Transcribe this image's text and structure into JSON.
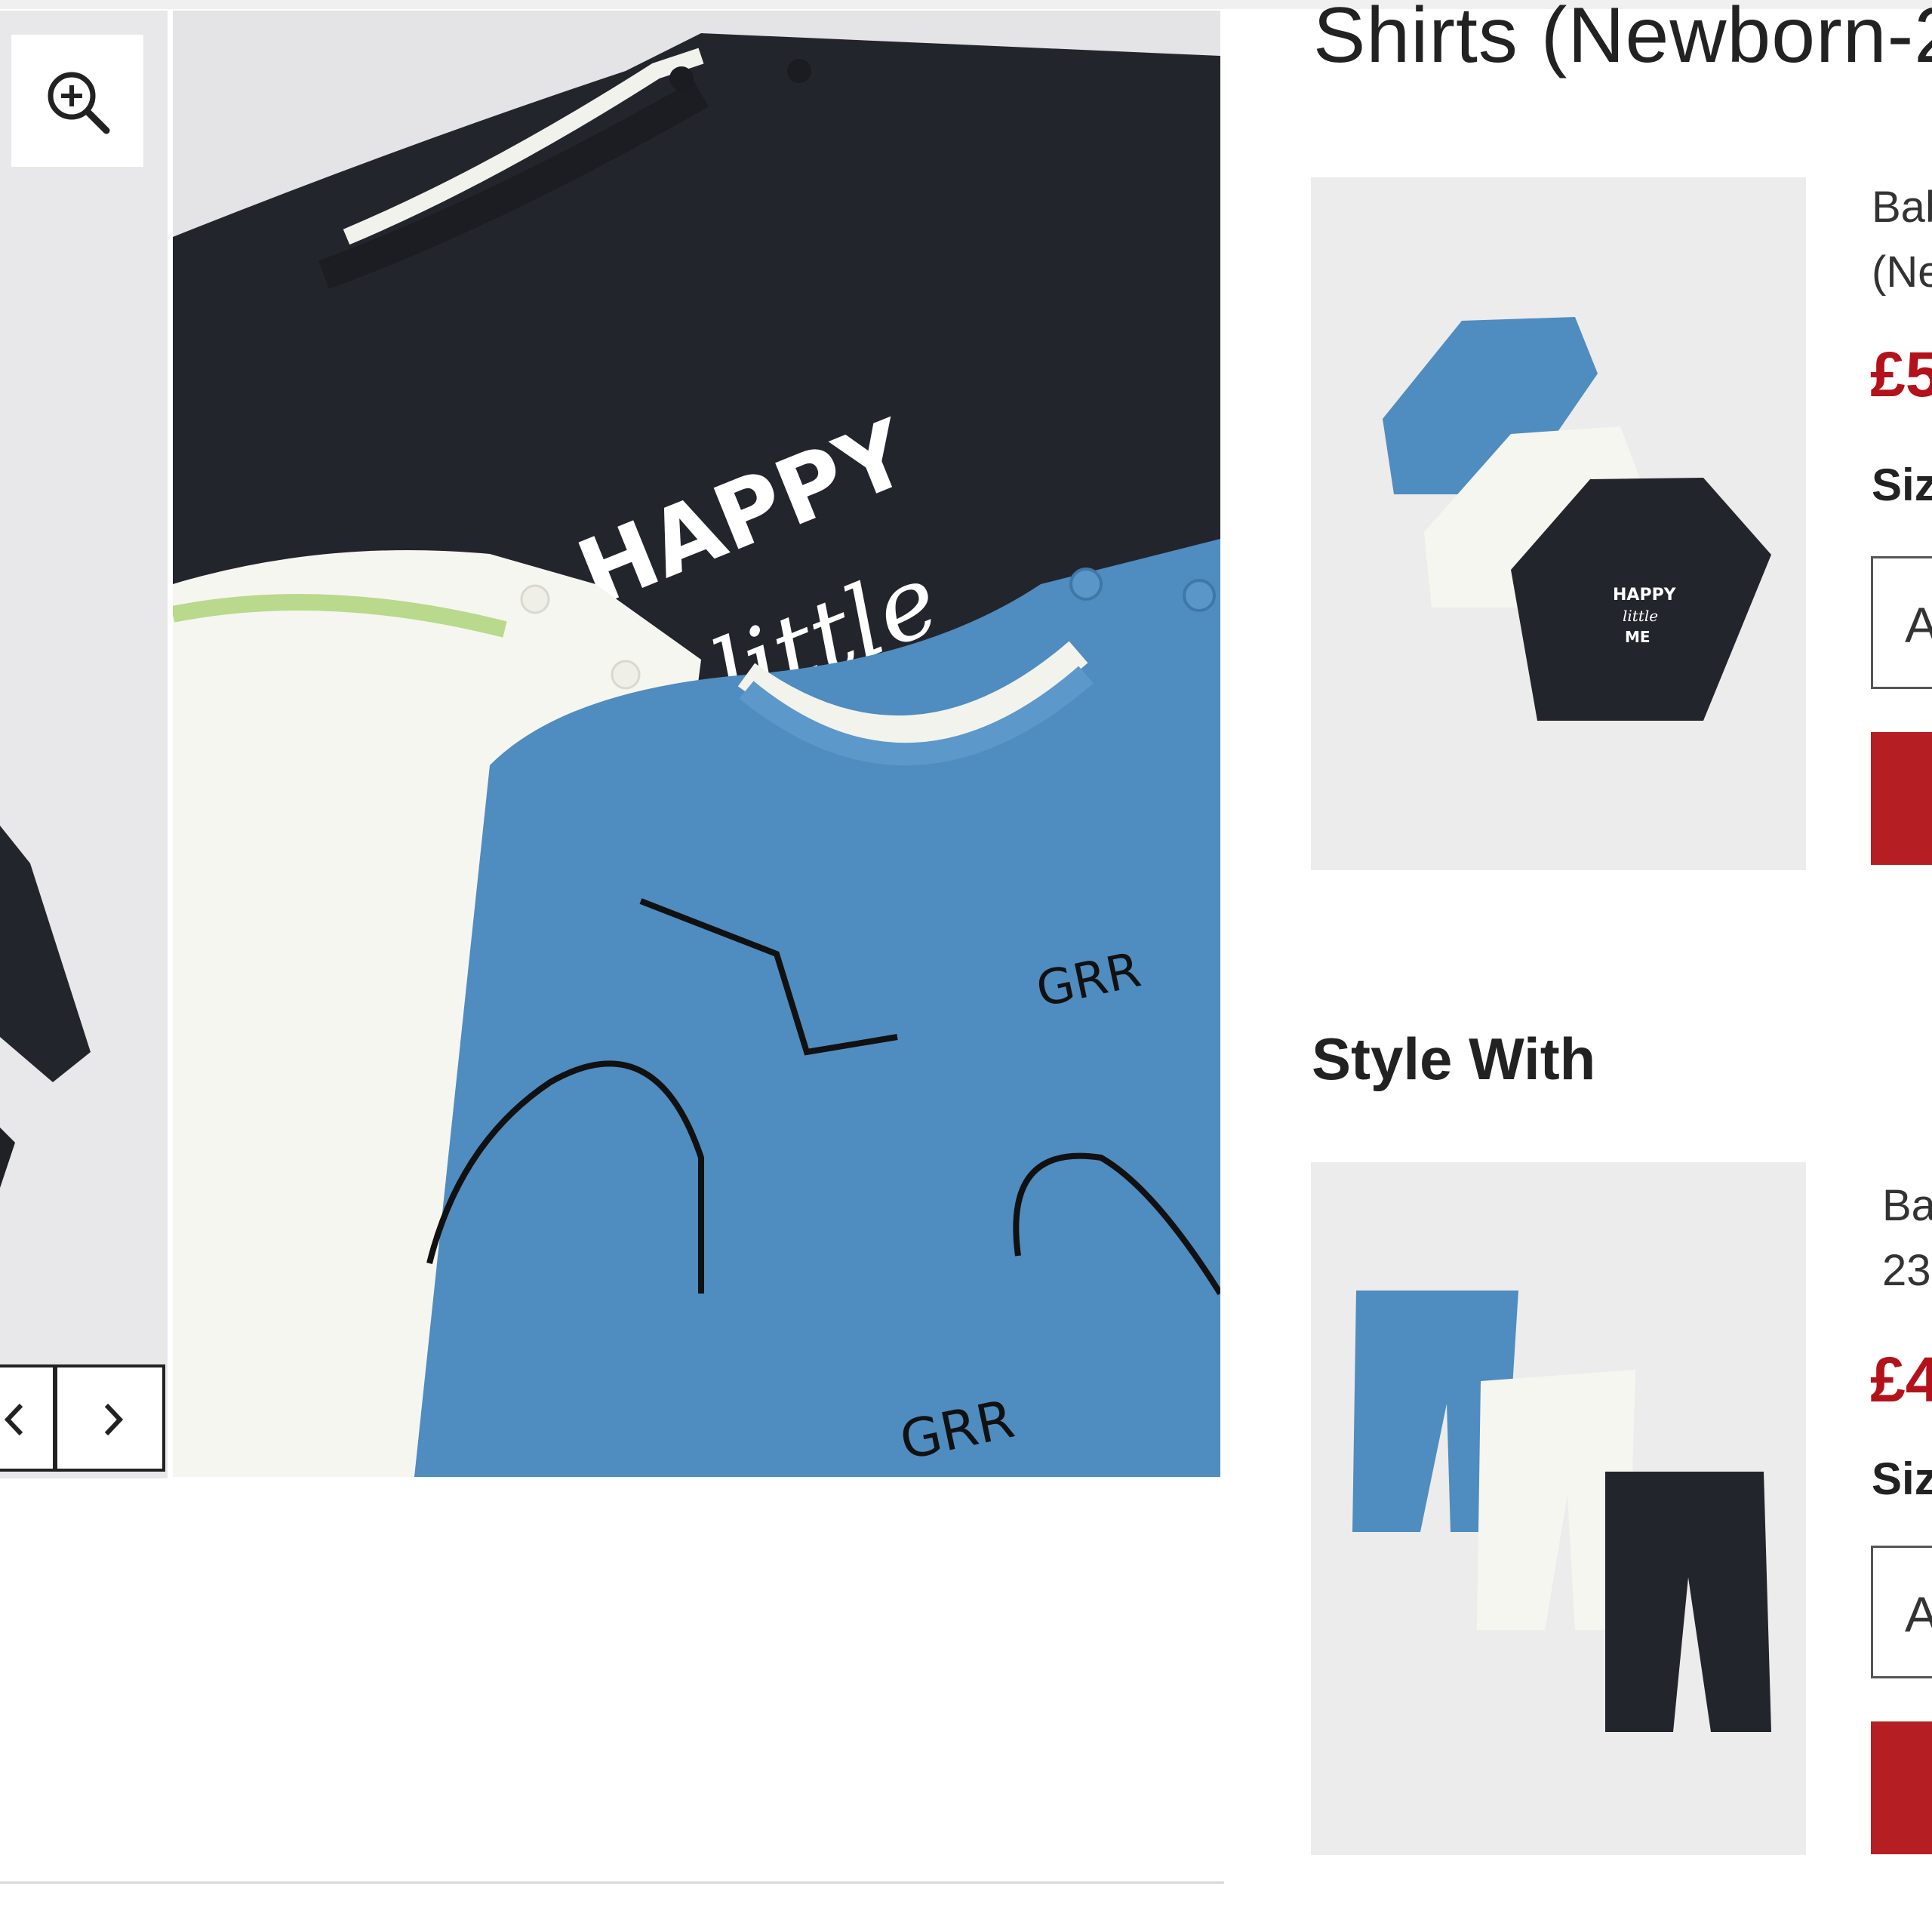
{
  "page": {
    "title": "Shirts (Newborn-2"
  },
  "gallery": {
    "zoom_icon": "zoom-in-icon",
    "prev_icon": "chevron-left-icon",
    "next_icon": "chevron-right-icon",
    "print_text": {
      "line1": "HAPPY",
      "line2": "little",
      "growl": "GRR"
    }
  },
  "recommended": [
    {
      "name": "Bab\n(Ne",
      "price": "£5",
      "size_label": "Siz",
      "size_value": "A",
      "image_print": [
        "HAPPY",
        "little",
        "ME"
      ]
    }
  ],
  "style_with": {
    "heading": "Style With",
    "items": [
      {
        "name": "Ba\n23",
        "price": "£4",
        "size_label": "Siz",
        "size_value": "A"
      }
    ]
  },
  "colors": {
    "price": "#b4121b",
    "add_button": "#b51f24",
    "navy_shirt": "#23252c",
    "blue_shirt": "#4f8cc0",
    "cream_shirt": "#f6f6f0"
  }
}
